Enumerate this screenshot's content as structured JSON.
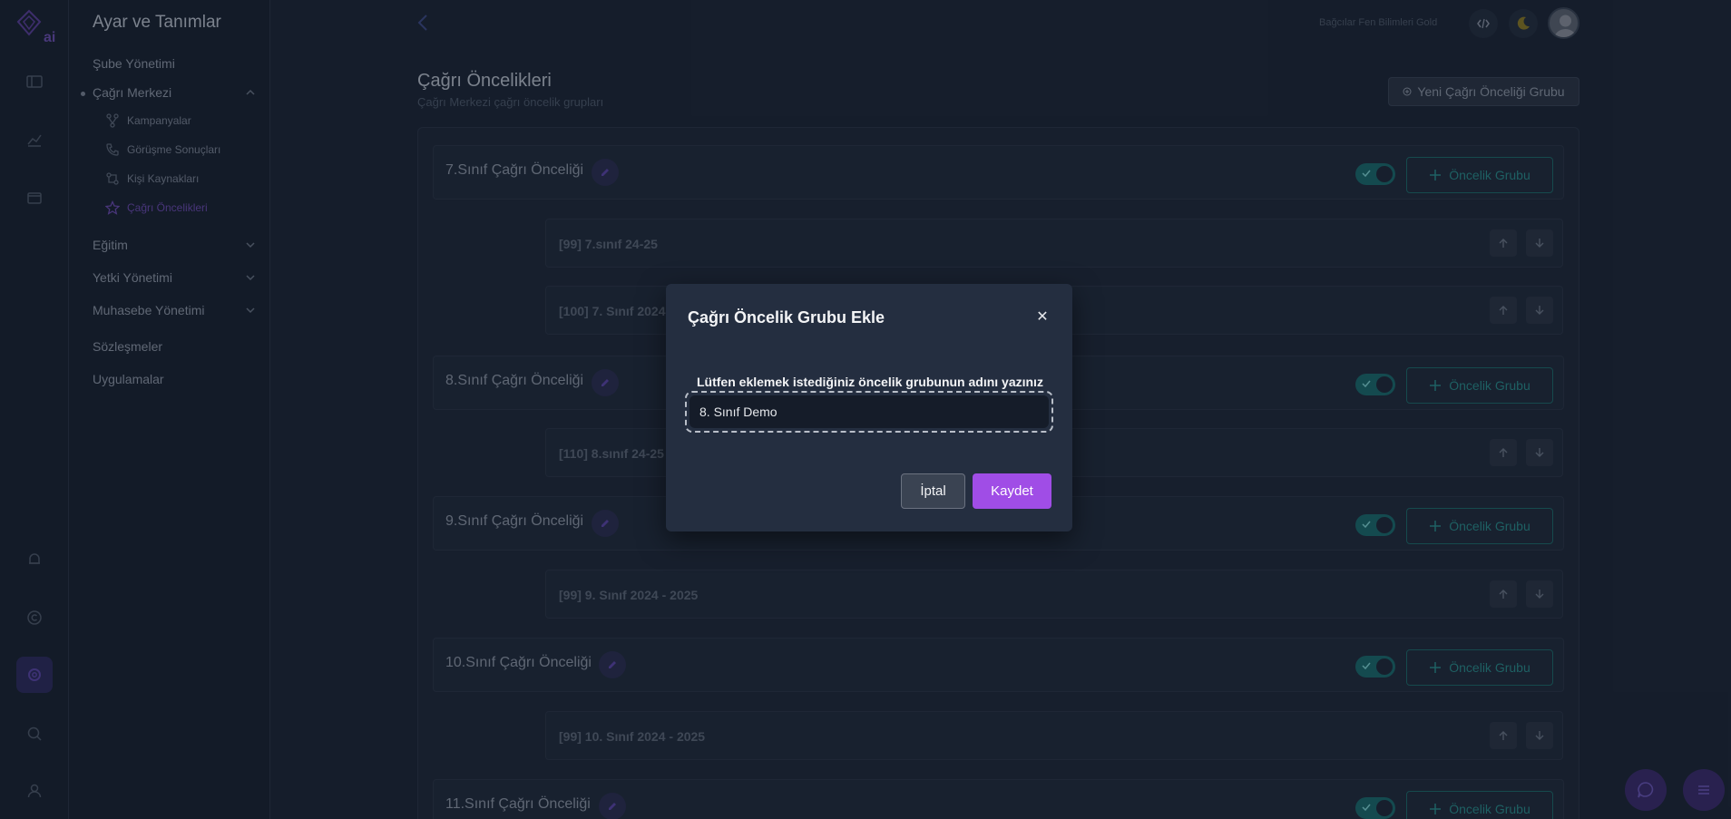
{
  "sidebar": {
    "title": "Ayar ve Tanımlar",
    "items": {
      "sube": "Şube Yönetimi",
      "cagri": "Çağrı Merkezi",
      "kampanyalar": "Kampanyalar",
      "gorusme": "Görüşme Sonuçları",
      "kisi": "Kişi Kaynakları",
      "oncelikler": "Çağrı Öncelikleri",
      "egitim": "Eğitim",
      "yetki": "Yetki Yönetimi",
      "muhasebe": "Muhasebe Yönetimi",
      "sozlesmeler": "Sözleşmeler",
      "uygulamalar": "Uygulamalar"
    }
  },
  "header": {
    "school": "Bağcılar Fen Bilimleri Gold"
  },
  "page": {
    "title": "Çağrı Öncelikleri",
    "subtitle": "Çağrı Merkezi çağrı öncelik grupları",
    "new_button": "Yeni Çağrı Önceliği Grubu",
    "group_button": "Öncelik Grubu"
  },
  "groups": [
    {
      "name": "7.Sınıf Çağrı Önceliği",
      "items": [
        "[99] 7.sınıf 24-25",
        "[100] 7. Sınıf 2024"
      ]
    },
    {
      "name": "8.Sınıf Çağrı Önceliği",
      "items": [
        "[110] 8.sınıf 24-25"
      ]
    },
    {
      "name": "9.Sınıf Çağrı Önceliği",
      "items": [
        "[99] 9. Sınıf 2024 - 2025"
      ]
    },
    {
      "name": "10.Sınıf Çağrı Önceliği",
      "items": [
        "[99] 10. Sınıf 2024 - 2025"
      ]
    },
    {
      "name": "11.Sınıf Çağrı Önceliği",
      "items": []
    }
  ],
  "modal": {
    "title": "Çağrı Öncelik Grubu Ekle",
    "label": "Lütfen eklemek istediğiniz öncelik grubunun adını yazınız",
    "input_value": "8. Sınıf Demo",
    "cancel": "İptal",
    "save": "Kaydet"
  },
  "colors": {
    "accent": "#a04de6",
    "teal": "#1b6b6e",
    "background": "#1d2637"
  }
}
